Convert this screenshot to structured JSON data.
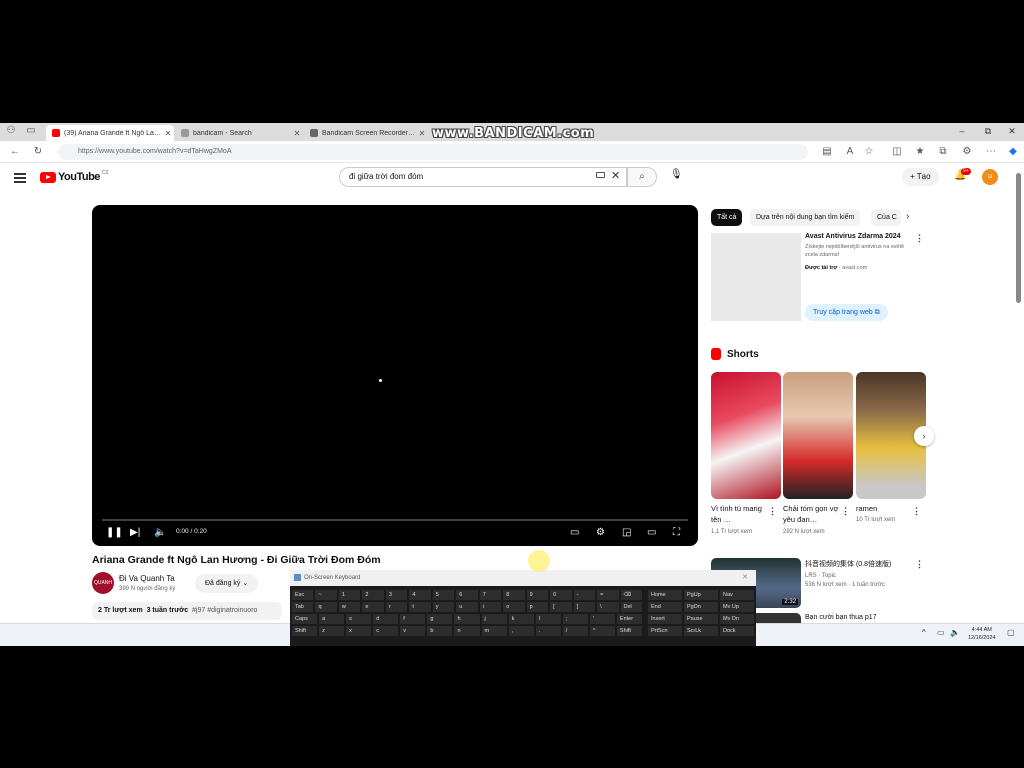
{
  "watermark": "www.BANDICAM.com",
  "browser": {
    "tabs": [
      {
        "label": "(39) Ariana Grande ft Ngô Lan Hư…",
        "color": "#ff0000"
      },
      {
        "label": "bandicam - Search",
        "color": "#888888"
      },
      {
        "label": "Bandicam Screen Recorder Down…",
        "color": "#555555"
      }
    ],
    "url": "https://www.youtube.com/watch?v=dTaHwgZMoA",
    "window_controls": [
      "–",
      "⧉",
      "✕"
    ]
  },
  "youtube": {
    "logo_text": "YouTube",
    "country_code": "CZ",
    "search_value": "đi giữa trời đom đóm",
    "create_label": "Tạo",
    "notification_count": "9+",
    "avatar_letter": "u"
  },
  "player": {
    "time": "0:00 / 0:20",
    "progress": 0
  },
  "video": {
    "title": "Ariana Grande ft Ngô Lan Hương - Đi Giữa Trời Đom Đóm",
    "channel_name": "Đi Va Quanh Ta",
    "channel_avatar_text": "QUANH TA",
    "subscribers": "399 N người đăng ký",
    "subscribe_label": "Đã đăng ký",
    "views": "2 Tr lượt xem",
    "age": "3 tuần trước",
    "tags": "#j97 #diginatroinuoro"
  },
  "sidebar": {
    "chips": [
      "Tất cả",
      "Dựa trên nội dung bạn tìm kiếm",
      "Của C"
    ],
    "ad": {
      "title": "Avast Antivirus Zdarma 2024",
      "description": "Získejte nejoblíbenější antivirus na světě zcela zdarma!",
      "sponsored": "Được tài trợ",
      "domain": "avast.com",
      "button": "Truy cập trang web"
    },
    "shorts_heading": "Shorts",
    "shorts": [
      {
        "title": "Vì tình tú mang tên …",
        "views": "1,1 Tr lượt xem"
      },
      {
        "title": "Chải tóm gọn vợ yêu đan…",
        "views": "292 N lượt xem"
      },
      {
        "title": "ramen",
        "views": "10 Tr lượt xem"
      }
    ],
    "recommended": [
      {
        "title": "抖音视频的集体 (0.8倍速版)",
        "meta1": "LRS · Topic",
        "meta2": "536 N lượt xem · 1 tuần trước",
        "duration": "2:32"
      },
      {
        "title": "Bạn cười bạn thua p17",
        "meta1": "",
        "meta2": "",
        "duration": ""
      }
    ]
  },
  "taskbar": {
    "time": "4:44 AM",
    "date": "12/16/2024"
  },
  "osk": {
    "title": "On-Screen Keyboard",
    "rows": [
      [
        "Esc",
        "~",
        "1",
        "2",
        "3",
        "4",
        "5",
        "6",
        "7",
        "8",
        "9",
        "0",
        "-",
        "=",
        "⌫",
        "Home",
        "PgUp",
        "Nav"
      ],
      [
        "Tab",
        "q",
        "w",
        "e",
        "r",
        "t",
        "y",
        "u",
        "i",
        "o",
        "p",
        "[",
        "]",
        "\\",
        "Del",
        "End",
        "PgDn",
        "Mv Up"
      ],
      [
        "Caps",
        "a",
        "s",
        "d",
        "f",
        "g",
        "h",
        "j",
        "k",
        "l",
        ";",
        "'",
        "Enter",
        "Insert",
        "Pause",
        "Mv Dn"
      ],
      [
        "Shift",
        "z",
        "x",
        "c",
        "v",
        "b",
        "n",
        "m",
        ",",
        ".",
        "/",
        "^",
        "Shift",
        "PrtScn",
        "ScrLk",
        "Dock"
      ]
    ]
  }
}
